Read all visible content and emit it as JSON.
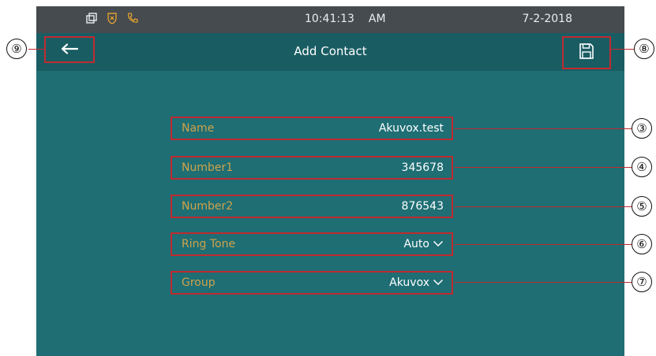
{
  "status_bar": {
    "icons": [
      "windows-icon",
      "shield-icon",
      "phone-icon"
    ],
    "time": "10:41:13",
    "ampm": "AM",
    "date": "7-2-2018"
  },
  "header": {
    "title": "Add Contact",
    "back_icon": "arrow-left-icon",
    "save_icon": "floppy-disk-icon"
  },
  "fields": [
    {
      "label": "Name",
      "value": "Akuvox.test",
      "dropdown": false
    },
    {
      "label": "Number1",
      "value": "345678",
      "dropdown": false
    },
    {
      "label": "Number2",
      "value": "876543",
      "dropdown": false
    },
    {
      "label": "Ring Tone",
      "value": "Auto",
      "dropdown": true
    },
    {
      "label": "Group",
      "value": "Akuvox",
      "dropdown": true
    }
  ],
  "callouts": {
    "back": "⑨",
    "save": "⑧",
    "name": "③",
    "number1": "④",
    "number2": "⑤",
    "ring_tone": "⑥",
    "group": "⑦"
  },
  "colors": {
    "background": "#1e6e74",
    "title_bar": "#195d63",
    "status_bar": "#454b4f",
    "label": "#cfa24a",
    "highlight": "#c02b30"
  }
}
